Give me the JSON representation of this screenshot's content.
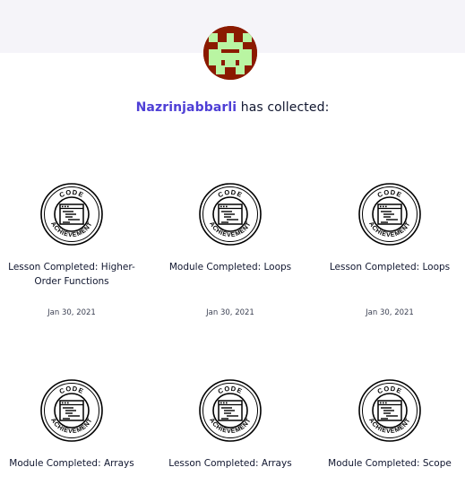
{
  "profile": {
    "username": "Nazrinjabbarli",
    "collected_suffix": " has collected:"
  },
  "badge": {
    "top_text": "CODE",
    "bottom_text": "ACHIEVEMENT",
    "icon": "code-window-icon"
  },
  "achievements": [
    {
      "title": "Lesson Completed: Higher-Order Functions",
      "date": "Jan 30, 2021"
    },
    {
      "title": "Module Completed: Loops",
      "date": "Jan 30, 2021"
    },
    {
      "title": "Lesson Completed: Loops",
      "date": "Jan 30, 2021"
    },
    {
      "title": "Module Completed: Arrays",
      "date": ""
    },
    {
      "title": "Lesson Completed: Arrays",
      "date": ""
    },
    {
      "title": "Module Completed: Scope",
      "date": ""
    }
  ],
  "colors": {
    "accent": "#4e3fd6",
    "avatar_bg": "#8b1a00",
    "avatar_fg": "#b9f5a2",
    "band": "#f5f4f9"
  }
}
